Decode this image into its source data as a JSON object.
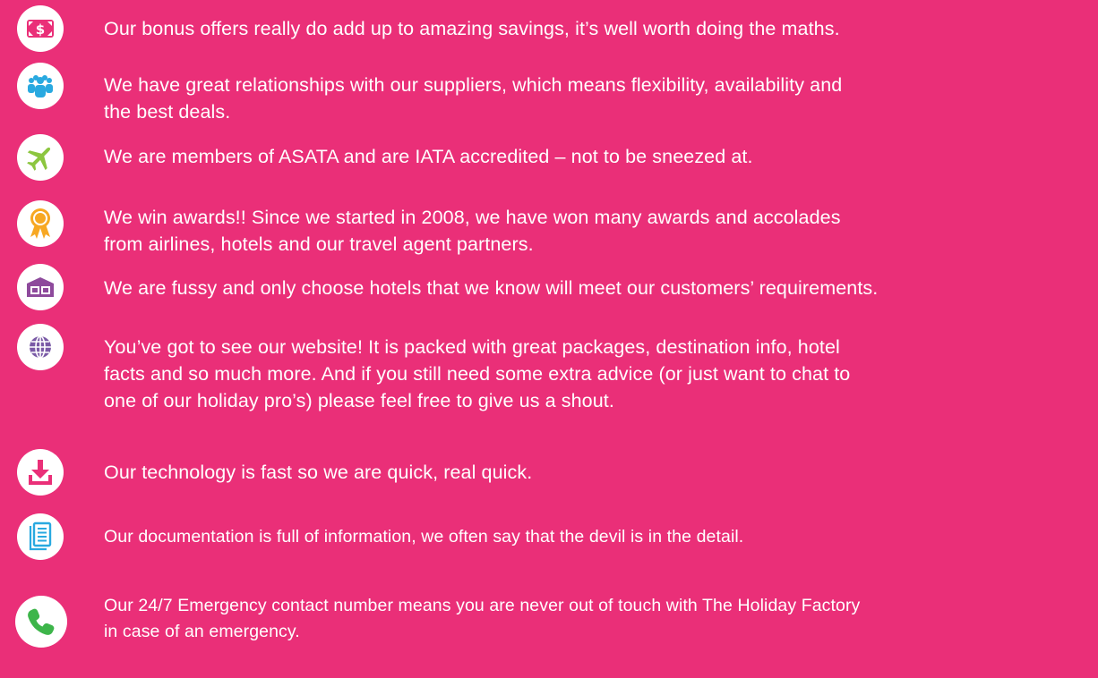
{
  "colors": {
    "background": "#ea2f78",
    "text": "#ffffff",
    "icon_circle": "#ffffff"
  },
  "features": [
    {
      "icon": "money-icon",
      "icon_color": "#ea2f78",
      "lines": [
        "Our bonus offers really do add up to amazing savings, it’s well worth doing the maths."
      ]
    },
    {
      "icon": "people-icon",
      "icon_color": "#29a9e0",
      "lines": [
        "We have great relationships with our suppliers, which means flexibility, availability and",
        "the best deals."
      ]
    },
    {
      "icon": "airplane-icon",
      "icon_color": "#8cc63f",
      "lines": [
        "We are members of ASATA and are IATA accredited –  not to be sneezed at."
      ]
    },
    {
      "icon": "award-ribbon-icon",
      "icon_color": "#f7a823",
      "lines": [
        "We win awards!! Since we started in 2008, we have won many awards and accolades",
        "from airlines, hotels and our travel agent partners."
      ]
    },
    {
      "icon": "hotel-icon",
      "icon_color": "#8e4a9c",
      "lines": [
        "We are fussy and only choose hotels that we know will meet our customers’ requirements."
      ]
    },
    {
      "icon": "globe-icon",
      "icon_color": "#7a5aa6",
      "lines": [
        "You’ve got to see our website! It is packed with great packages, destination info, hotel",
        "facts and so much more. And if you still need some extra advice (or just want to chat to",
        "one of our holiday pro’s) please feel free to give us a shout."
      ]
    },
    {
      "icon": "download-icon",
      "icon_color": "#ea2f78",
      "lines": [
        "Our technology is fast so we are quick, real quick."
      ]
    },
    {
      "icon": "document-icon",
      "icon_color": "#29a9e0",
      "lines": [
        "Our documentation is full of information, we often say that the devil is in the detail."
      ]
    },
    {
      "icon": "phone-icon",
      "icon_color": "#3db54a",
      "lines": [
        "Our 24/7 Emergency contact number means you are never out of touch with The Holiday Factory",
        "in case of an emergency."
      ]
    }
  ]
}
